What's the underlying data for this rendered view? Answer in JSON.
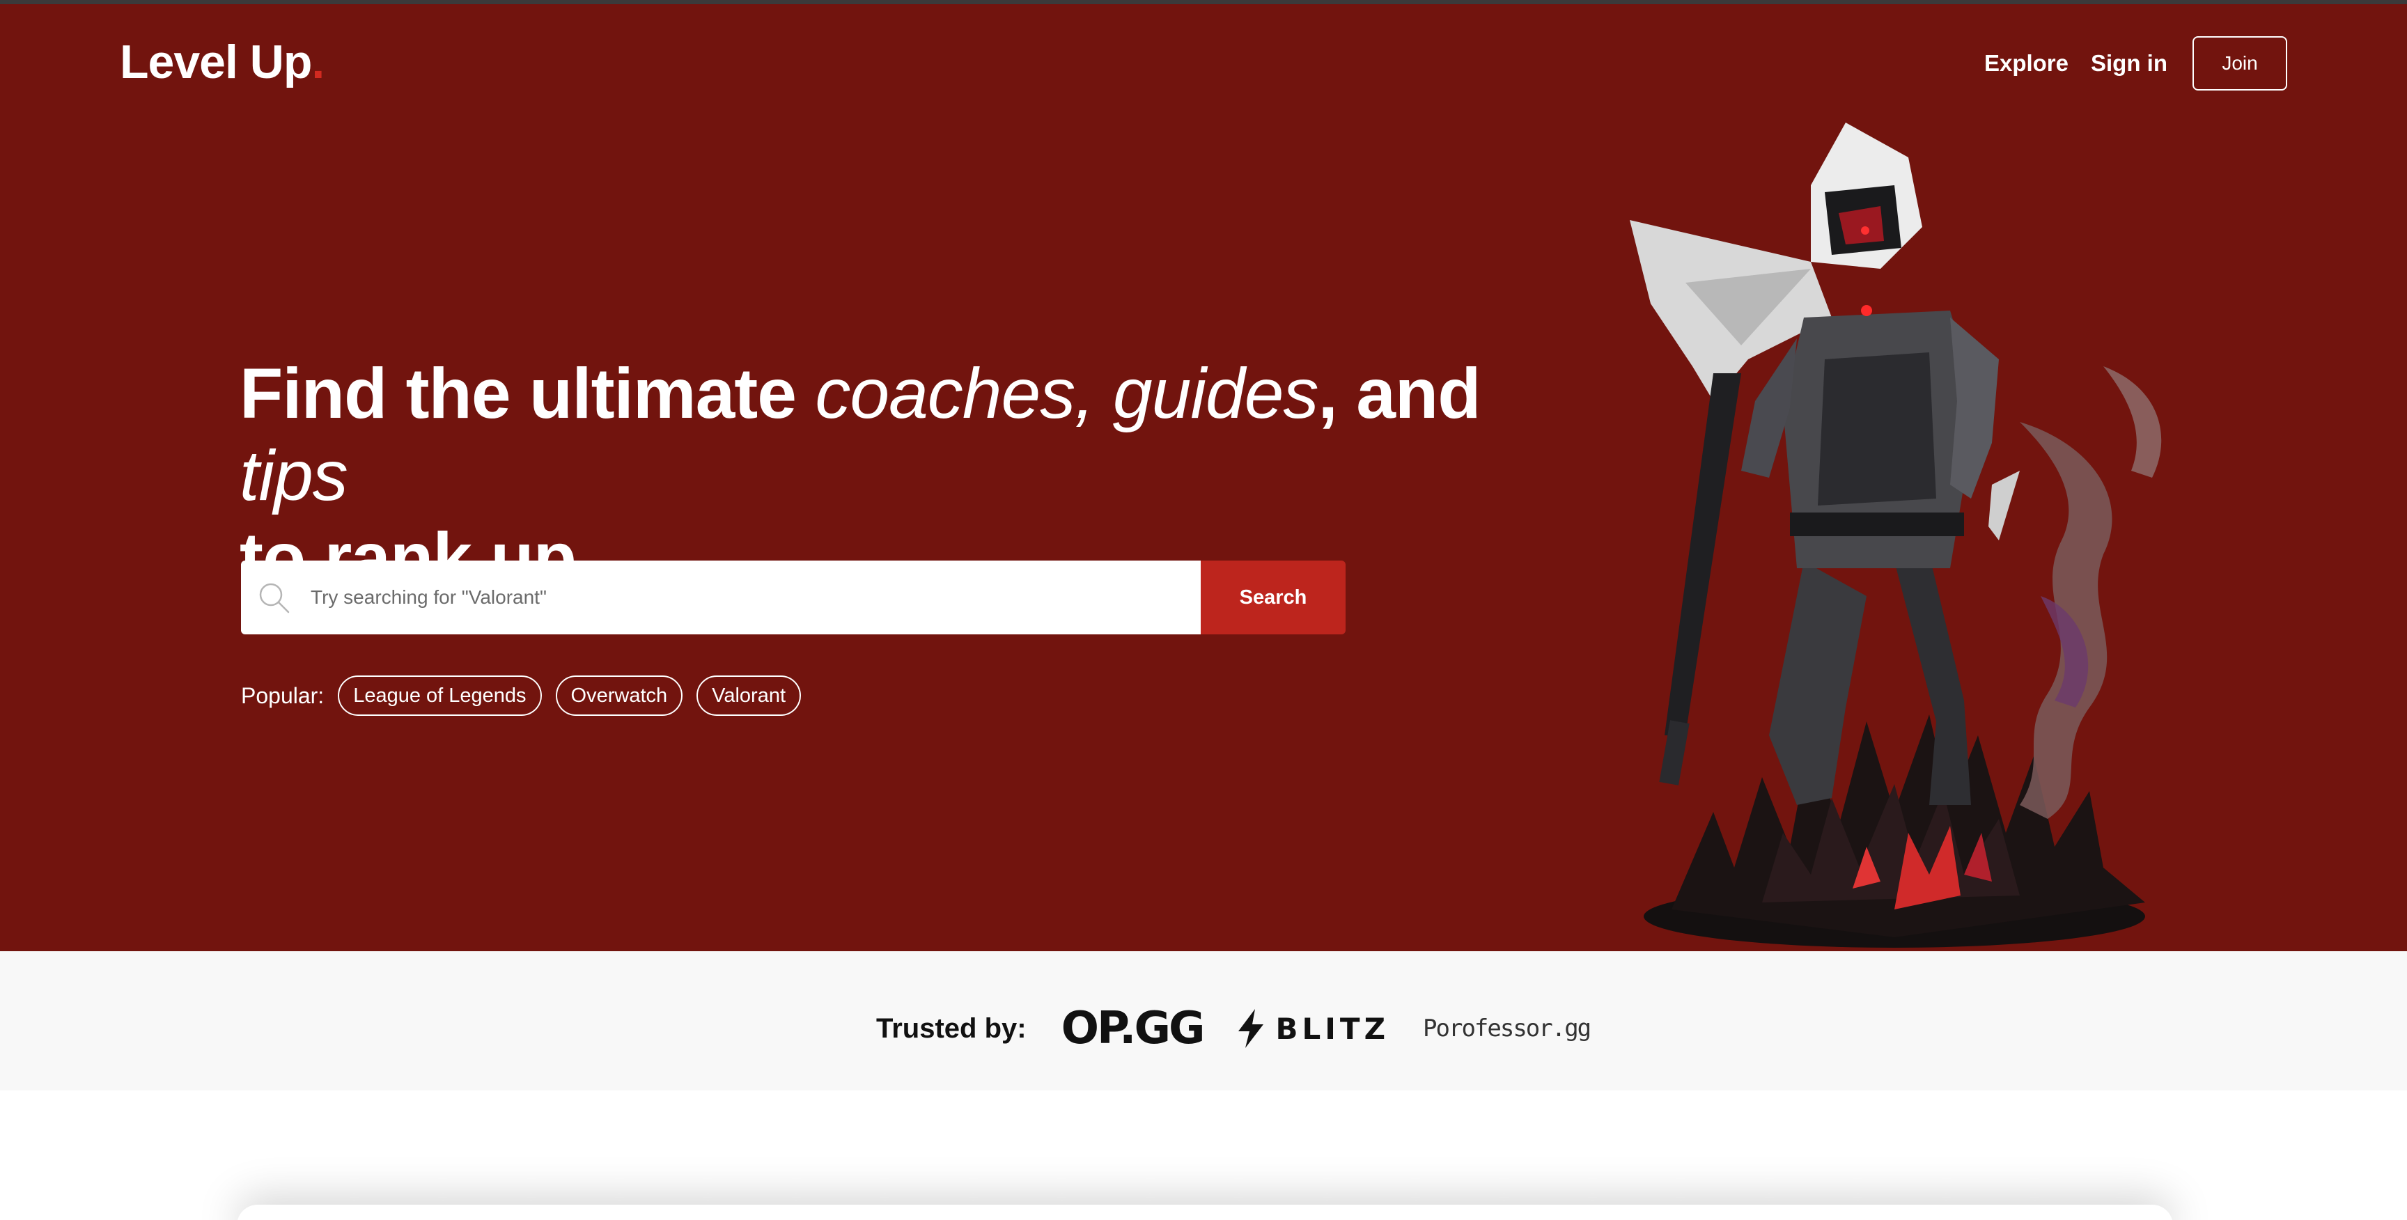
{
  "brand": {
    "name": "Level Up",
    "dot": ".",
    "accent": "#d12a20"
  },
  "nav": {
    "explore": "Explore",
    "sign_in": "Sign in",
    "join": "Join"
  },
  "hero": {
    "bg": "#72140e",
    "headline": {
      "p1": "Find the ultimate ",
      "p2": "coaches, guides",
      "p3": ", and ",
      "p4": "tips",
      "p5": "to rank up."
    },
    "search": {
      "placeholder": "Try searching for \"Valorant\"",
      "button": "Search",
      "icon": "search-icon"
    },
    "popular": {
      "label": "Popular:",
      "items": [
        "League of Legends",
        "Overwatch",
        "Valorant"
      ]
    },
    "illustration": "hooded-ninja-character"
  },
  "trusted": {
    "label": "Trusted by:",
    "logos": {
      "opgg": "OP.GG",
      "blitz": "BLITZ",
      "porofessor": "Porofessor.gg"
    }
  }
}
